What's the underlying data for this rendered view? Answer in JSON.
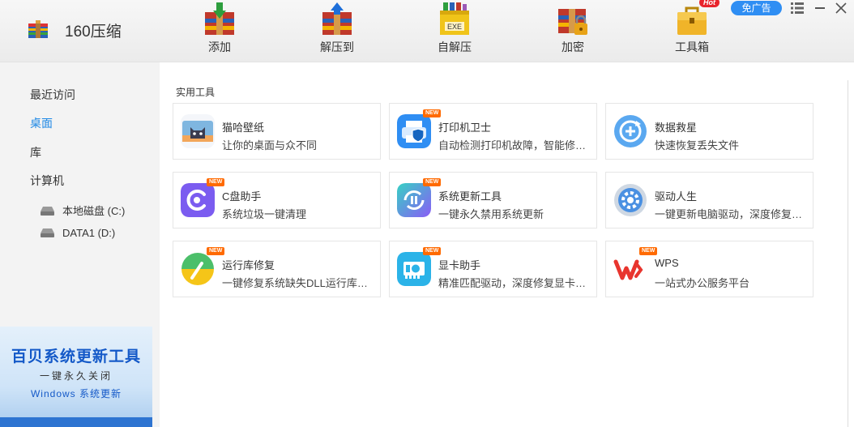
{
  "app": {
    "title": "160压缩"
  },
  "toolbar": [
    {
      "label": "添加",
      "icon": "add-archive-icon"
    },
    {
      "label": "解压到",
      "icon": "extract-to-icon"
    },
    {
      "label": "自解压",
      "icon": "self-extract-exe-icon"
    },
    {
      "label": "加密",
      "icon": "encrypt-lock-icon"
    },
    {
      "label": "工具箱",
      "icon": "toolbox-icon",
      "badge": "Hot"
    }
  ],
  "window": {
    "ad_free_label": "免广告"
  },
  "sidebar": {
    "items": [
      {
        "label": "最近访问",
        "active": false
      },
      {
        "label": "桌面",
        "active": true
      },
      {
        "label": "库",
        "active": false
      },
      {
        "label": "计算机",
        "active": false
      }
    ],
    "drives": [
      {
        "label": "本地磁盘 (C:)"
      },
      {
        "label": "DATA1 (D:)"
      }
    ]
  },
  "banner": {
    "title": "百贝系统更新工具",
    "subtitle": "一键永久关闭",
    "tagline": "Windows 系统更新"
  },
  "main": {
    "section_title": "实用工具",
    "new_label": "NEW",
    "tools": [
      {
        "name": "猫哈壁纸",
        "desc": "让你的桌面与众不同",
        "icon": "wallpaper-cat-icon",
        "new": false
      },
      {
        "name": "打印机卫士",
        "desc": "自动检测打印机故障，智能修复...",
        "icon": "printer-guard-icon",
        "new": true
      },
      {
        "name": "数据救星",
        "desc": "快速恢复丢失文件",
        "icon": "data-recovery-icon",
        "new": false
      },
      {
        "name": "C盘助手",
        "desc": "系统垃圾一键清理",
        "icon": "c-drive-cleaner-icon",
        "new": true
      },
      {
        "name": "系统更新工具",
        "desc": "一键永久禁用系统更新",
        "icon": "system-update-pause-icon",
        "new": true
      },
      {
        "name": "驱动人生",
        "desc": "一键更新电脑驱动，深度修复硬...",
        "icon": "driver-gear-icon",
        "new": false
      },
      {
        "name": "运行库修复",
        "desc": "一键修复系统缺失DLL运行库文...",
        "icon": "runtime-repair-icon",
        "new": true
      },
      {
        "name": "显卡助手",
        "desc": "精准匹配驱动，深度修复显卡故...",
        "icon": "graphics-card-icon",
        "new": true
      },
      {
        "name": "WPS",
        "desc": "一站式办公服务平台",
        "icon": "wps-logo-icon",
        "new": true
      }
    ]
  },
  "colors": {
    "accent": "#1e88e5",
    "ad_button": "#2f8ef3",
    "hot_badge": "#e8242c",
    "new_badge": "#ff6a00",
    "banner_title": "#1459c8"
  }
}
